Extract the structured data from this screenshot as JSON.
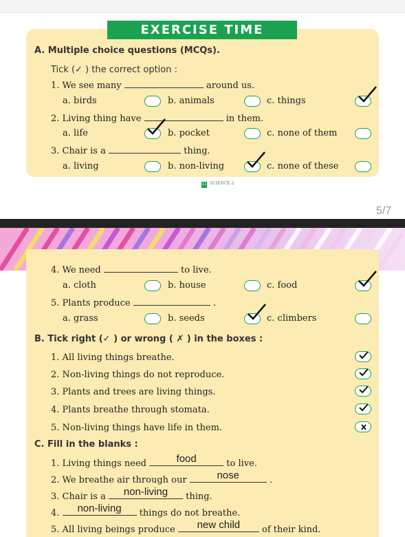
{
  "banner": "EXERCISE TIME",
  "page_indicator": "5/7",
  "footer_text": "SCIENCE-2",
  "footer_num": "11",
  "sectionA": {
    "title": "A.  Multiple choice questions (MCQs).",
    "instruction": "Tick (✓ ) the correct option :",
    "questions": [
      {
        "prefix": "1. We see many",
        "suffix": "around us.",
        "options": [
          "a. birds",
          "b. animals",
          "c. things"
        ],
        "ticked": 2
      },
      {
        "prefix": "2. Living thing have",
        "suffix": "in them.",
        "options": [
          "a. life",
          "b. pocket",
          "c. none of them"
        ],
        "ticked": 0
      },
      {
        "prefix": "3. Chair is a",
        "suffix": "thing.",
        "options": [
          "a. living",
          "b. non-living",
          "c. none of these"
        ],
        "ticked": 1
      },
      {
        "prefix": "4. We need",
        "suffix": "to live.",
        "options": [
          "a. cloth",
          "b. house",
          "c. food"
        ],
        "ticked": 2
      },
      {
        "prefix": "5. Plants produce",
        "suffix": ".",
        "options": [
          "a. grass",
          "b. seeds",
          "c. climbers"
        ],
        "ticked": 1
      }
    ]
  },
  "sectionB": {
    "title": "B.  Tick right (✓ ) or wrong ( ✗ ) in the boxes :",
    "items": [
      {
        "text": "1. All living things breathe.",
        "mark": "tick"
      },
      {
        "text": "2. Non-living things do not reproduce.",
        "mark": "tick"
      },
      {
        "text": "3. Plants and trees are living things.",
        "mark": "tick"
      },
      {
        "text": "4. Plants breathe through stomata.",
        "mark": "tick"
      },
      {
        "text": "5. Non-living things have life in them.",
        "mark": "cross"
      }
    ]
  },
  "sectionC": {
    "title": "C.  Fill in the blanks :",
    "items": [
      {
        "prefix": "1. Living things need",
        "answer": "food",
        "suffix": "to live."
      },
      {
        "prefix": "2. We breathe air through our",
        "answer": "nose",
        "suffix": "."
      },
      {
        "prefix": "3. Chair is a",
        "answer": "non-living",
        "suffix": "thing."
      },
      {
        "prefix": "4.",
        "answer": "non-living",
        "suffix": "things do not breathe."
      },
      {
        "prefix": "5. All living beings produce",
        "answer": "new child",
        "suffix": "of their kind."
      }
    ]
  }
}
